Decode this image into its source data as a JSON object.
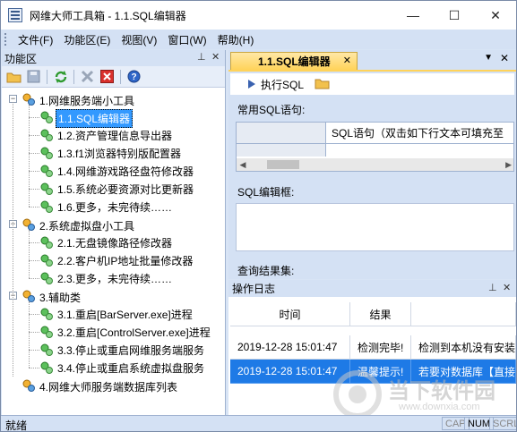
{
  "window": {
    "title": "网维大师工具箱 - 1.1.SQL编辑器",
    "min_glyph": "—",
    "max_glyph": "☐",
    "close_glyph": "✕"
  },
  "menu": [
    "文件(F)",
    "功能区(E)",
    "视图(V)",
    "窗口(W)",
    "帮助(H)"
  ],
  "left_panel": {
    "title": "功能区",
    "pin_glyph": "ᵩ",
    "close_glyph": "✕",
    "toolbar_icons": [
      "folder-open-icon",
      "save-icon",
      "refresh-icon",
      "delete-icon",
      "remove-icon",
      "help-icon"
    ]
  },
  "tree": {
    "groups": [
      {
        "label": "1.网维服务端小工具",
        "items": [
          "1.1.SQL编辑器",
          "1.2.资产管理信息导出器",
          "1.3.f1浏览器特别版配置器",
          "1.4.网维游戏路径盘符修改器",
          "1.5.系统必要资源对比更新器",
          "1.6.更多，未完待续……"
        ]
      },
      {
        "label": "2.系统虚拟盘小工具",
        "items": [
          "2.1.无盘镜像路径修改器",
          "2.2.客户机IP地址批量修改器",
          "2.3.更多，未完待续……"
        ]
      },
      {
        "label": "3.辅助类",
        "items": [
          "3.1.重启[BarServer.exe]进程",
          "3.2.重启[ControlServer.exe]进程",
          "3.3.停止或重启网维服务端服务",
          "3.4.停止或重启系统虚拟盘服务"
        ]
      },
      {
        "label": "4.网维大师服务端数据库列表",
        "items": []
      }
    ],
    "selected": "1.1.SQL编辑器"
  },
  "doc": {
    "tab_label": "1.1.SQL编辑器",
    "tab_close": "✕",
    "tab_menu": "▼",
    "tab_x": "✕",
    "execute_label": "执行SQL",
    "common_sql_label": "常用SQL语句:",
    "grid_header": "SQL语句（双击如下行文本可填充至",
    "sql_editor_label": "SQL编辑框:",
    "results_label": "查询结果集:"
  },
  "log": {
    "title": "操作日志",
    "columns": [
      "时间",
      "结果",
      ""
    ],
    "rows": [
      {
        "time": "2019-12-28 15:01:47",
        "result": "检测完毕!",
        "detail": "检测到本机没有安装"
      },
      {
        "time": "2019-12-28 15:01:47",
        "result": "温馨提示!",
        "detail": "若要对数据库【直接"
      }
    ]
  },
  "watermark": {
    "brand": "当下软件园",
    "url": "www.downxia.com"
  },
  "status": {
    "text": "就绪",
    "indicators": [
      "CAP",
      "NUM",
      "SCRL"
    ]
  },
  "colors": {
    "accent": "#3399ff",
    "tab_active": "#ffd35a",
    "chrome": "#d4e1f4",
    "selection": "#1e7ae6"
  }
}
